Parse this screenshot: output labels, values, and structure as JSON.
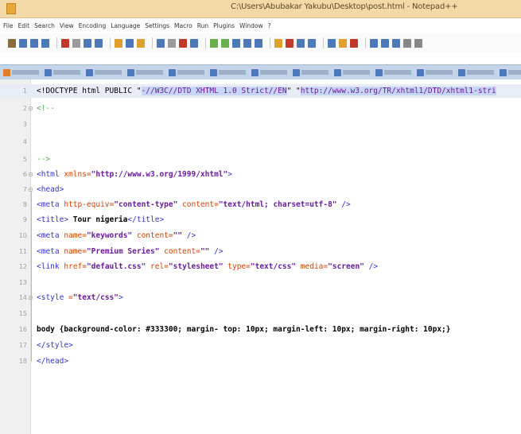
{
  "window": {
    "title": "C:\\Users\\Abubakar Yakubu\\Desktop\\post.html - Notepad++"
  },
  "menu": [
    "File",
    "Edit",
    "Search",
    "View",
    "Encoding",
    "Language",
    "Settings",
    "Macro",
    "Run",
    "Plugins",
    "Window",
    "?"
  ],
  "tabs": [
    "",
    "",
    "",
    "",
    "",
    "",
    "",
    "",
    "",
    "",
    "",
    "",
    ""
  ],
  "editor": {
    "lines": [
      {
        "n": "1",
        "segs": [
          {
            "c": "doctype",
            "t": "<!DOCTYPE html PUBLIC \""
          },
          {
            "c": "sel",
            "t": "-//W3C//DTD XHTML 1.0 Strict//EN"
          },
          {
            "c": "doctype",
            "t": "\" \""
          },
          {
            "c": "sel",
            "t": "http://www.w3.org/TR/xhtml1/DTD/xhtml1-stri"
          }
        ]
      },
      {
        "n": "2",
        "segs": [
          {
            "c": "cmt",
            "t": "<!--"
          }
        ]
      },
      {
        "n": "3",
        "segs": []
      },
      {
        "n": "4",
        "segs": []
      },
      {
        "n": "5",
        "segs": [
          {
            "c": "cmt",
            "t": "-->"
          }
        ]
      },
      {
        "n": "6",
        "segs": [
          {
            "c": "tag",
            "t": "<html "
          },
          {
            "c": "attr",
            "t": "xmlns="
          },
          {
            "c": "str",
            "t": "\"http://www.w3.org/1999/xhtml\""
          },
          {
            "c": "tag",
            "t": ">"
          }
        ]
      },
      {
        "n": "7",
        "segs": [
          {
            "c": "tag",
            "t": "<head>"
          }
        ]
      },
      {
        "n": "8",
        "segs": [
          {
            "c": "tag",
            "t": "<meta "
          },
          {
            "c": "attr",
            "t": "http-equiv="
          },
          {
            "c": "str",
            "t": "\"content-type\""
          },
          {
            "c": "attr",
            "t": " content="
          },
          {
            "c": "str",
            "t": "\"text/html; charset=utf-8\""
          },
          {
            "c": "tag",
            "t": " />"
          }
        ]
      },
      {
        "n": "9",
        "segs": [
          {
            "c": "tag",
            "t": "<title>"
          },
          {
            "c": "txt",
            "t": " Tour nigeria"
          },
          {
            "c": "tag",
            "t": "</title>"
          }
        ]
      },
      {
        "n": "10",
        "segs": [
          {
            "c": "tag",
            "t": "<meta "
          },
          {
            "c": "attr",
            "t": "name="
          },
          {
            "c": "str",
            "t": "\"keywords\""
          },
          {
            "c": "attr",
            "t": " content="
          },
          {
            "c": "str",
            "t": "\"\""
          },
          {
            "c": "tag",
            "t": " />"
          }
        ]
      },
      {
        "n": "11",
        "segs": [
          {
            "c": "tag",
            "t": "<meta "
          },
          {
            "c": "attr",
            "t": "name="
          },
          {
            "c": "str",
            "t": "\"Premium Series\""
          },
          {
            "c": "attr",
            "t": " content="
          },
          {
            "c": "str",
            "t": "\"\""
          },
          {
            "c": "tag",
            "t": " />"
          }
        ]
      },
      {
        "n": "12",
        "segs": [
          {
            "c": "tag",
            "t": "<link "
          },
          {
            "c": "attr",
            "t": "href="
          },
          {
            "c": "str",
            "t": "\"default.css\""
          },
          {
            "c": "attr",
            "t": " rel="
          },
          {
            "c": "str",
            "t": "\"stylesheet\""
          },
          {
            "c": "attr",
            "t": " type="
          },
          {
            "c": "str",
            "t": "\"text/css\""
          },
          {
            "c": "attr",
            "t": " media="
          },
          {
            "c": "str",
            "t": "\"screen\""
          },
          {
            "c": "tag",
            "t": " />"
          }
        ]
      },
      {
        "n": "13",
        "segs": []
      },
      {
        "n": "14",
        "segs": [
          {
            "c": "tag",
            "t": "<style "
          },
          {
            "c": "attr",
            "t": "="
          },
          {
            "c": "str",
            "t": "\"text/css\""
          },
          {
            "c": "tag",
            "t": ">"
          }
        ]
      },
      {
        "n": "15",
        "segs": []
      },
      {
        "n": "16",
        "segs": [
          {
            "c": "txt",
            "t": "body {background-color: #333300; margin- top: 10px; margin-left: 10px; margin-right: 10px;}"
          }
        ]
      },
      {
        "n": "17",
        "segs": [
          {
            "c": "tag",
            "t": "</style>"
          }
        ]
      },
      {
        "n": "18",
        "segs": [
          {
            "c": "tag",
            "t": "</head>"
          }
        ]
      }
    ]
  },
  "colors": {
    "titlebar": "#f3d9a5",
    "tabbar": "#c4d5ea",
    "tag": "#3333cc",
    "attribute": "#cc4400",
    "string": "#6a1b9a",
    "comment": "#4caf50"
  }
}
